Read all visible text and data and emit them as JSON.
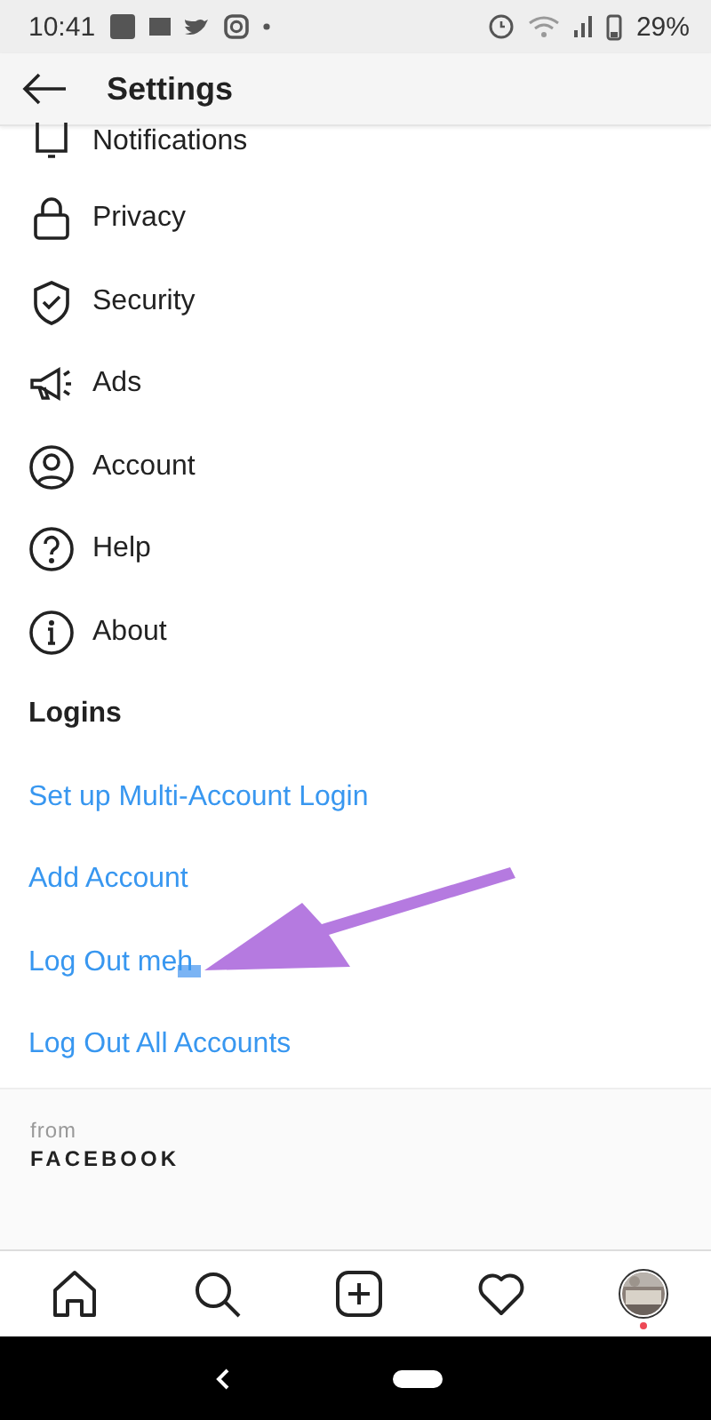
{
  "status_bar": {
    "time": "10:41",
    "battery": "29%"
  },
  "header": {
    "title": "Settings"
  },
  "menu_items": [
    {
      "label": "Notifications",
      "kind": "bell"
    },
    {
      "label": "Privacy",
      "kind": "lock"
    },
    {
      "label": "Security",
      "kind": "shield"
    },
    {
      "label": "Ads",
      "kind": "megaphone"
    },
    {
      "label": "Account",
      "kind": "person"
    },
    {
      "label": "Help",
      "kind": "help"
    },
    {
      "label": "About",
      "kind": "info"
    }
  ],
  "logins": {
    "title": "Logins",
    "links": [
      {
        "label": "Set up Multi-Account Login",
        "redacted": false
      },
      {
        "label": "Add Account",
        "redacted": false
      },
      {
        "label": "Log Out meh",
        "redacted": true
      },
      {
        "label": "Log Out All Accounts",
        "redacted": false
      }
    ]
  },
  "footer": {
    "from": "from",
    "brand": "FACEBOOK"
  },
  "bottom_nav": [
    {
      "kind": "home"
    },
    {
      "kind": "search"
    },
    {
      "kind": "add"
    },
    {
      "kind": "heart"
    },
    {
      "kind": "profile",
      "badge": true
    }
  ]
}
